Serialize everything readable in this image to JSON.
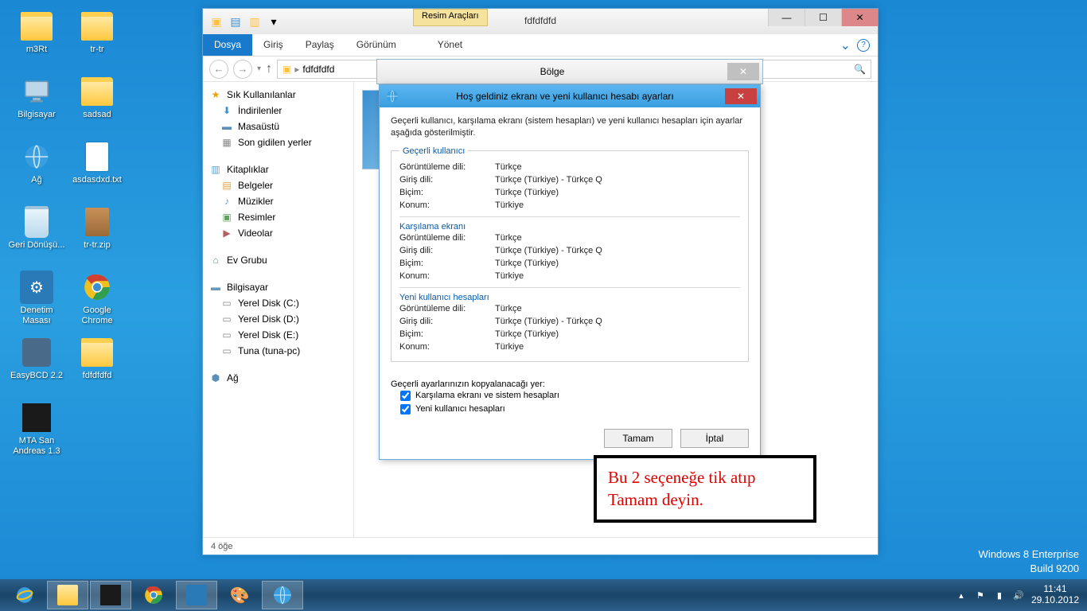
{
  "desktop": {
    "col1": [
      {
        "name": "user-folder",
        "label": "m3Rt",
        "icon": "fold"
      },
      {
        "name": "computer",
        "label": "Bilgisayar",
        "icon": "comp"
      },
      {
        "name": "network",
        "label": "Ağ",
        "icon": "net"
      },
      {
        "name": "recycle-bin",
        "label": "Geri Dönüşü...",
        "icon": "bin"
      },
      {
        "name": "control-panel",
        "label": "Denetim Masası",
        "icon": "ctrl"
      },
      {
        "name": "easybcd",
        "label": "EasyBCD 2.2",
        "icon": "app"
      },
      {
        "name": "mta",
        "label": "MTA San Andreas 1.3",
        "icon": "dark"
      }
    ],
    "col2": [
      {
        "name": "trtr-folder",
        "label": "tr-tr",
        "icon": "fold"
      },
      {
        "name": "sadsad-folder",
        "label": "sadsad",
        "icon": "fold"
      },
      {
        "name": "txt-file",
        "label": "asdasdxd.txt",
        "icon": "file"
      },
      {
        "name": "trtr-zip",
        "label": "tr-tr.zip",
        "icon": "zip"
      },
      {
        "name": "chrome",
        "label": "Google Chrome",
        "icon": "chrome"
      },
      {
        "name": "fdfdfdfd-folder",
        "label": "fdfdfdfd",
        "icon": "fold"
      }
    ]
  },
  "watermark": {
    "line1": "Windows 8 Enterprise",
    "line2": "Build 9200"
  },
  "explorer": {
    "title": "fdfdfdfd",
    "tool_tab": "Resim Araçları",
    "ribbon": {
      "file": "Dosya",
      "home": "Giriş",
      "share": "Paylaş",
      "view": "Görünüm",
      "manage": "Yönet"
    },
    "breadcrumb": "fdfdfdfd",
    "search_placeholder": "",
    "tree": {
      "fav": "Sık Kullanılanlar",
      "dl": "İndirilenler",
      "desk": "Masaüstü",
      "recent": "Son gidilen yerler",
      "libs": "Kitaplıklar",
      "docs": "Belgeler",
      "music": "Müzikler",
      "pics": "Resimler",
      "vids": "Videolar",
      "home": "Ev Grubu",
      "comp": "Bilgisayar",
      "c": "Yerel Disk (C:)",
      "d": "Yerel Disk (D:)",
      "e": "Yerel Disk (E:)",
      "tuna": "Tuna (tuna-pc)",
      "net": "Ağ"
    },
    "status": "4 öğe"
  },
  "region_title": "Bölge",
  "dialog": {
    "title": "Hoş geldiniz ekranı ve yeni kullanıcı hesabı ayarları",
    "desc": "Geçerli kullanıcı, karşılama ekranı (sistem hesapları) ve yeni kullanıcı hesapları için ayarlar aşağıda gösterilmiştir.",
    "sect1": "Geçerli kullanıcı",
    "sect2": "Karşılama ekranı",
    "sect3": "Yeni kullanıcı hesapları",
    "k_display": "Görüntüleme dili:",
    "k_input": "Giriş dili:",
    "k_format": "Biçim:",
    "k_loc": "Konum:",
    "v_display": "Türkçe",
    "v_input": "Türkçe (Türkiye) - Türkçe Q",
    "v_format": "Türkçe (Türkiye)",
    "v_loc": "Türkiye",
    "copy_label": "Geçerli ayarlarınızın kopyalanacağı yer:",
    "chk1": "Karşılama ekranı ve sistem hesapları",
    "chk2": "Yeni kullanıcı hesapları",
    "ok": "Tamam",
    "cancel": "İptal"
  },
  "annotation": "Bu 2 seçeneğe tik atıp Tamam deyin.",
  "tray": {
    "time": "11:41",
    "date": "29.10.2012"
  }
}
